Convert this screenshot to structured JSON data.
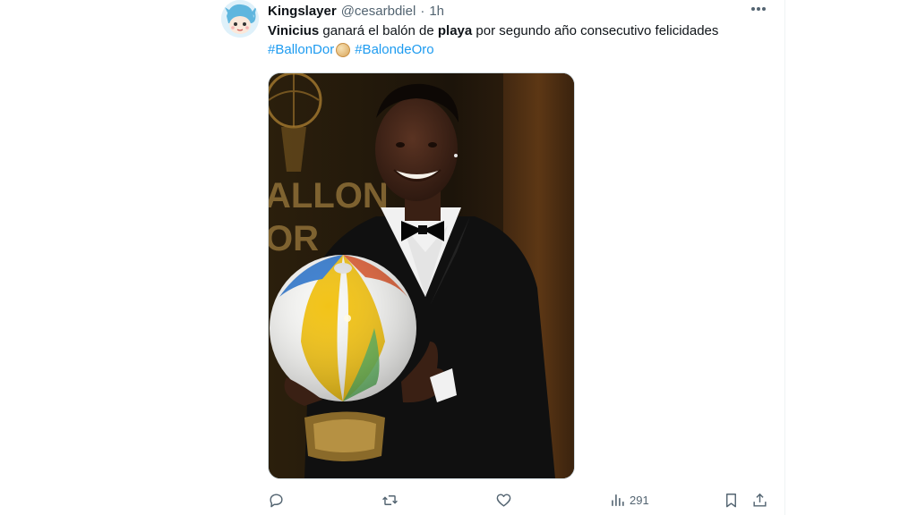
{
  "tweet": {
    "display_name": "Kingslayer",
    "handle": "@cesarbdiel",
    "separator": "·",
    "time": "1h",
    "more_icon": "more-horizontal-icon",
    "text": {
      "part1_bold": "Vinicius",
      "part2": " ganará el balón de ",
      "part3_bold": "playa",
      "part4": " por segundo año consecutivo felicidades"
    },
    "hashtags": [
      "#BallonDor",
      "#BalondeOro"
    ],
    "media": {
      "description_icon": "photo",
      "backdrop_text_lines": [
        "ALLON",
        "OR"
      ]
    },
    "actions": {
      "reply_icon": "reply-icon",
      "retweet_icon": "retweet-icon",
      "like_icon": "heart-icon",
      "views_icon": "views-icon",
      "views_count": "291",
      "bookmark_icon": "bookmark-icon",
      "share_icon": "share-icon"
    }
  },
  "colors": {
    "link": "#1d9bf0",
    "muted": "#536471",
    "text": "#0f1419"
  }
}
